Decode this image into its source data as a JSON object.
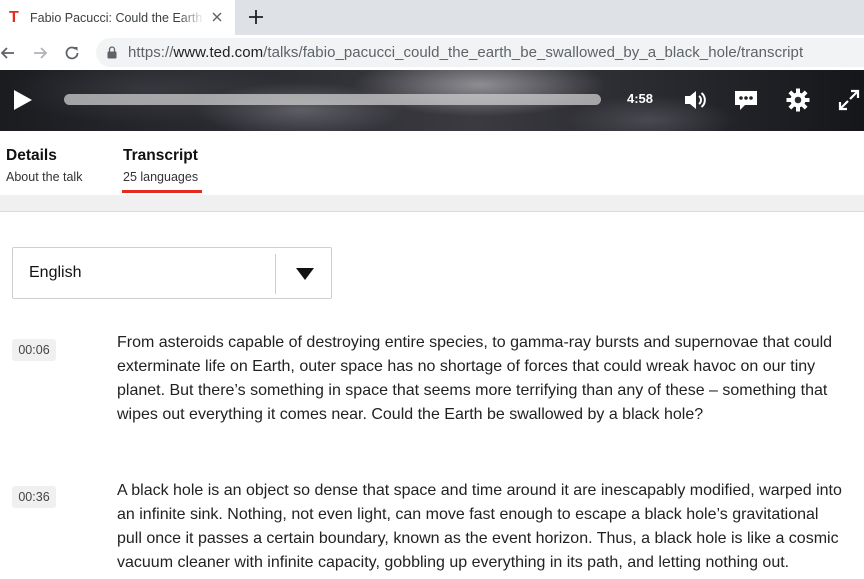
{
  "browser": {
    "tab_title": "Fabio Pacucci: Could the Earth be swallowed by a black hole?",
    "favicon_letter": "T",
    "url_scheme": "https://",
    "url_host": "www.ted.com",
    "url_path": "/talks/fabio_pacucci_could_the_earth_be_swallowed_by_a_black_hole/transcript"
  },
  "player": {
    "time": "4:58",
    "progress": 0.0
  },
  "talk_tabs": [
    {
      "title": "Details",
      "subtitle": "About the talk"
    },
    {
      "title": "Transcript",
      "subtitle": "25 languages"
    }
  ],
  "language": {
    "selected": "English"
  },
  "transcript": [
    {
      "time": "00:06",
      "lines": [
        "From asteroids capable of destroying entire species, to gamma-ray bursts and supernovae that could",
        "exterminate life on Earth, outer space has no shortage of forces that could wreak havoc on our tiny",
        "planet. But there’s something in space that seems more terrifying than any of these – something that",
        "wipes out everything it comes near. Could the Earth be swallowed by a black hole?"
      ]
    },
    {
      "time": "00:36",
      "lines": [
        "A black hole is an object so dense that space and time around it are inescapably modified, warped into",
        "an infinite sink. Nothing, not even light, can move fast enough to escape a black hole’s gravitational",
        "pull once it passes a certain boundary, known as the event horizon. Thus, a black hole is like a cosmic",
        "vacuum cleaner with infinite capacity, gobbling up everything in its path, and letting nothing out."
      ]
    }
  ],
  "colors": {
    "accent": "#e62b1e"
  }
}
